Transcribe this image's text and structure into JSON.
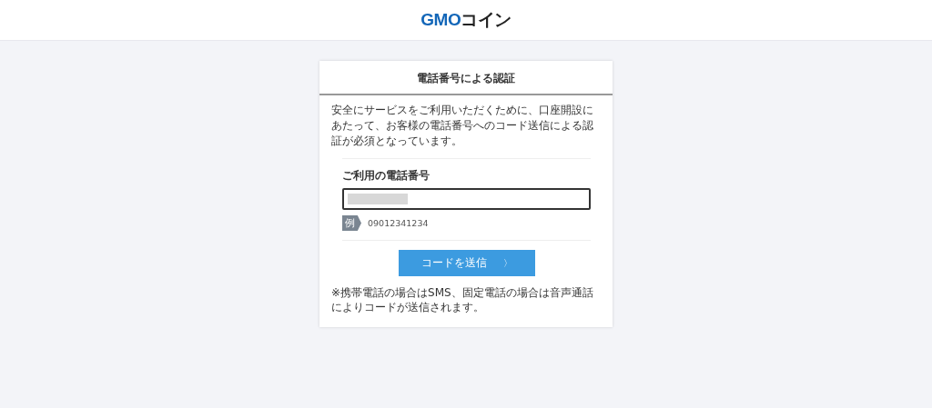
{
  "header": {
    "logo": {
      "brand": "GMO",
      "product": "コイン"
    }
  },
  "card": {
    "title": "電話番号による認証",
    "intro": "安全にサービスをご利用いただくために、口座開設にあたって、お客様の電話番号へのコード送信による認証が必須となっています。",
    "phone_field": {
      "label": "ご利用の電話番号",
      "redacted": true
    },
    "example": {
      "badge": "例",
      "value": "09012341234"
    },
    "submit_button": {
      "label": "コードを送信",
      "arrow": "〉"
    },
    "note": "※携帯電話の場合はSMS、固定電話の場合は音声通話によりコードが送信されます。"
  }
}
